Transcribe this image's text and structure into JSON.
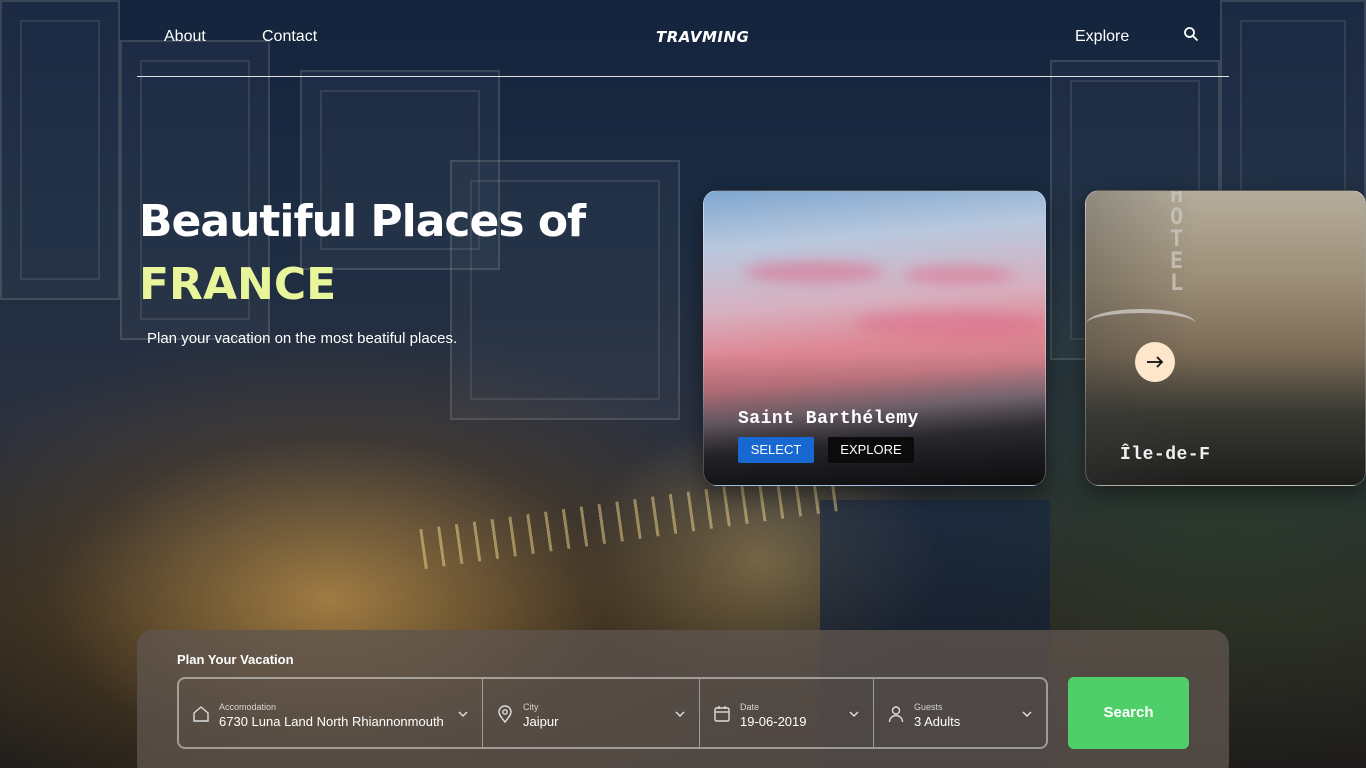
{
  "nav": {
    "left_links": [
      "About",
      "Contact"
    ],
    "logo": "TRAVMING",
    "right_link": "Explore",
    "search_icon": "search-icon"
  },
  "hero": {
    "title": "Beautiful Places of",
    "accent": "FRANCE",
    "subtitle": "Plan your vacation on the most beatiful places."
  },
  "cards": [
    {
      "name": "Saint Barthélemy",
      "select_label": "SELECT",
      "explore_label": "EXPLORE"
    },
    {
      "name": "Île-de-F"
    }
  ],
  "carousel": {
    "next_icon": "arrow-right-icon"
  },
  "plan": {
    "title": "Plan Your Vacation",
    "fields": [
      {
        "icon": "home-icon",
        "label": "Accomodation",
        "value": "6730 Luna Land North Rhiannonmouth"
      },
      {
        "icon": "location-pin-icon",
        "label": "City",
        "value": "Jaipur"
      },
      {
        "icon": "calendar-icon",
        "label": "Date",
        "value": "19-06-2019"
      },
      {
        "icon": "user-icon",
        "label": "Guests",
        "value": "3 Adults"
      }
    ],
    "search_label": "Search"
  },
  "colors": {
    "accent_text": "#e9f59a",
    "select_button": "#1769d1",
    "search_button": "#4fcf6a",
    "next_button": "#fde6c9"
  }
}
